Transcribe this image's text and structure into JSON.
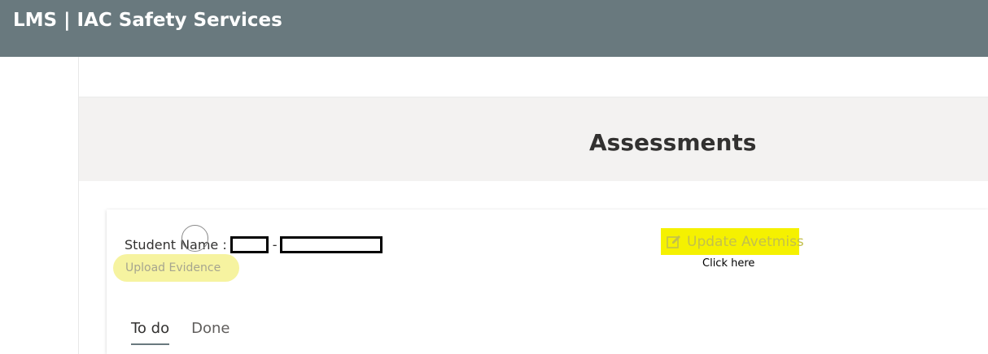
{
  "header": {
    "app_title": "LMS | IAC Safety Services"
  },
  "page": {
    "title": "Assessments"
  },
  "card": {
    "student_name_label": "Student Name :",
    "separator": "-",
    "upload_evidence_label": "Upload Evidence",
    "update_avetmiss_label": "Update Avetmiss",
    "click_here_note": "Click here",
    "edit_icon": "edit-icon"
  },
  "tabs": [
    {
      "label": "To do",
      "active": true
    },
    {
      "label": "Done",
      "active": false
    }
  ],
  "colors": {
    "header_bg": "#69797e",
    "hero_bg": "#f3f2f1",
    "highlight_yellow": "#f5f100",
    "upload_pill_bg": "#f6f3a0"
  }
}
